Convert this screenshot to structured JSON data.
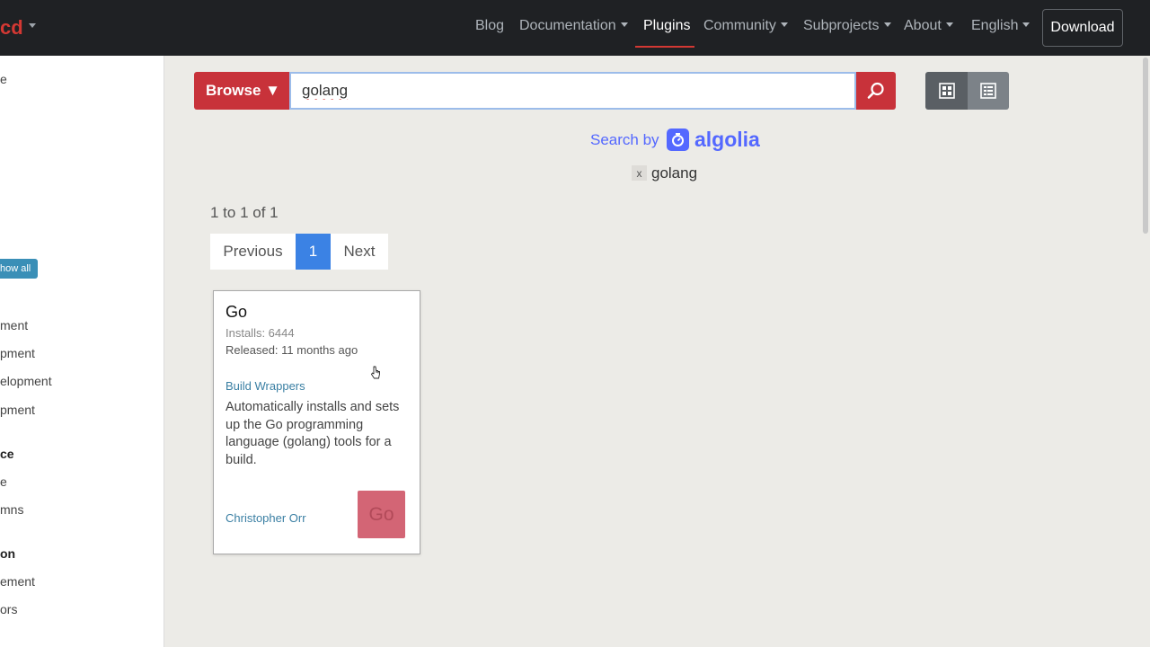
{
  "navbar": {
    "brand_text": "cd",
    "items": [
      {
        "label": "Blog",
        "has_caret": false
      },
      {
        "label": "Documentation",
        "has_caret": true
      },
      {
        "label": "Plugins",
        "has_caret": false,
        "active": true
      },
      {
        "label": "Community",
        "has_caret": true
      },
      {
        "label": "Subprojects",
        "has_caret": true
      },
      {
        "label": "About",
        "has_caret": true
      },
      {
        "label": "English",
        "has_caret": true
      }
    ],
    "download_label": "Download"
  },
  "sidebar": {
    "items": [
      {
        "text": "e",
        "kind": "text"
      },
      {
        "text": "how all",
        "kind": "button"
      },
      {
        "text": "ment",
        "kind": "text"
      },
      {
        "text": "pment",
        "kind": "text"
      },
      {
        "text": "elopment",
        "kind": "text"
      },
      {
        "text": "pment",
        "kind": "text"
      },
      {
        "text": "ce",
        "kind": "heading"
      },
      {
        "text": "e",
        "kind": "text"
      },
      {
        "text": "mns",
        "kind": "text"
      },
      {
        "text": "on",
        "kind": "heading"
      },
      {
        "text": "ement",
        "kind": "text"
      },
      {
        "text": "ors",
        "kind": "text"
      }
    ]
  },
  "search": {
    "browse_label": "Browse ▼",
    "query": "golang",
    "search_by_label": "Search by",
    "algolia_label": "algolia",
    "active_filter": "golang",
    "filter_remove": "x"
  },
  "results": {
    "summary": "1 to 1 of 1",
    "pager": {
      "prev": "Previous",
      "current": "1",
      "next": "Next"
    },
    "cards": [
      {
        "title": "Go",
        "installs": "Installs: 6444",
        "released": "Released: 11 months ago",
        "category": "Build Wrappers",
        "description": "Automatically installs and sets up the Go programming language (golang) tools for a build.",
        "author": "Christopher Orr",
        "logo_text": "Go"
      }
    ]
  },
  "colors": {
    "accent_red": "#c8323a",
    "algolia_blue": "#5468ff",
    "page_active_blue": "#3b82e4",
    "navbar_bg": "#1f2124"
  },
  "icons": [
    "search-icon",
    "grid-view-icon",
    "list-view-icon",
    "algolia-logo-icon",
    "chevron-down-icon",
    "cursor-icon"
  ]
}
